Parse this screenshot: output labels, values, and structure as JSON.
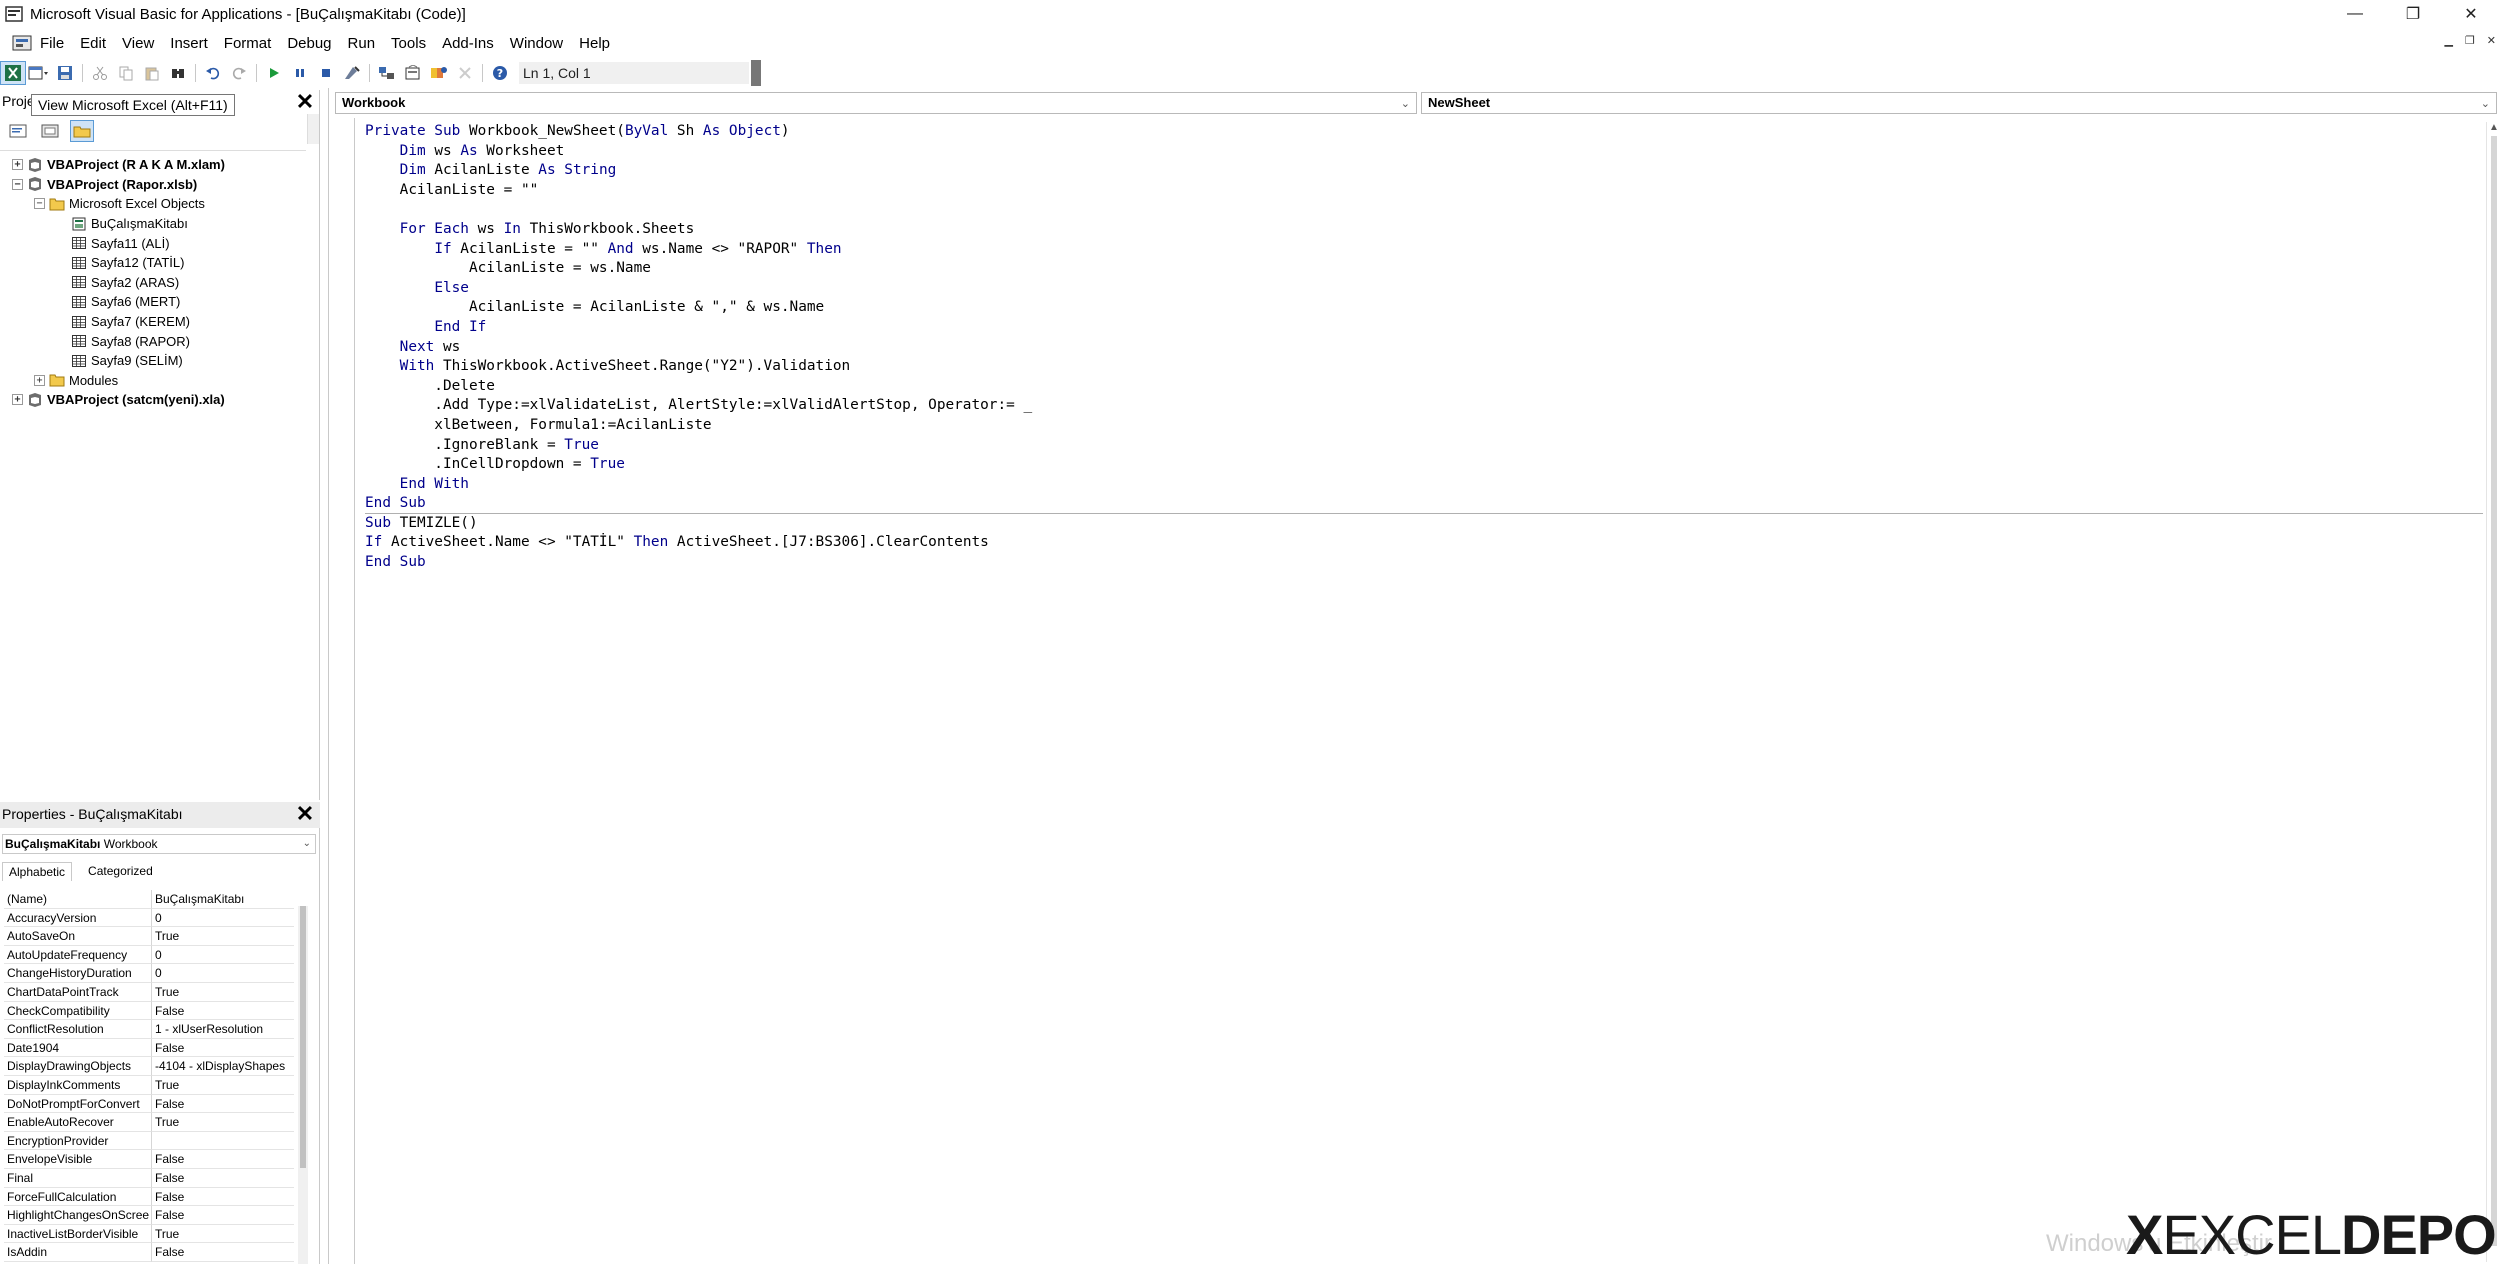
{
  "window": {
    "title": "Microsoft Visual Basic for Applications - [BuÇalışmaKitabı (Code)]",
    "minimize_glyph": "—",
    "restore_glyph": "❐",
    "close_glyph": "✕"
  },
  "menu": {
    "items": [
      "File",
      "Edit",
      "View",
      "Insert",
      "Format",
      "Debug",
      "Run",
      "Tools",
      "Add-Ins",
      "Window",
      "Help"
    ],
    "mdi_buttons": [
      "▁",
      "❐",
      "✕"
    ]
  },
  "toolbar": {
    "cursor_position": "Ln 1, Col 1",
    "tooltip": "View Microsoft Excel (Alt+F11)",
    "icons": [
      "excel-view-icon",
      "insert-userform-icon",
      "save-icon",
      "cut-icon",
      "copy-icon",
      "paste-icon",
      "find-icon",
      "undo-icon",
      "redo-icon",
      "run-icon",
      "break-icon",
      "reset-icon",
      "design-mode-icon",
      "project-explorer-icon",
      "properties-window-icon",
      "object-browser-icon",
      "toolbox-icon",
      "help-icon"
    ]
  },
  "project_pane": {
    "title": "Proje",
    "close_label": "✕",
    "tree": [
      {
        "label": "VBAProject (R A K A M.xlam)",
        "level": 0,
        "expander": "+",
        "bold": true,
        "icon": "vbaproject-icon"
      },
      {
        "label": "VBAProject (Rapor.xlsb)",
        "level": 0,
        "expander": "−",
        "bold": true,
        "icon": "vbaproject-icon"
      },
      {
        "label": "Microsoft Excel Objects",
        "level": 1,
        "expander": "−",
        "bold": false,
        "icon": "folder-icon"
      },
      {
        "label": "BuÇalışmaKitabı",
        "level": 2,
        "expander": "",
        "bold": false,
        "icon": "workbook-icon"
      },
      {
        "label": "Sayfa11 (ALİ)",
        "level": 2,
        "expander": "",
        "bold": false,
        "icon": "worksheet-icon"
      },
      {
        "label": "Sayfa12 (TATİL)",
        "level": 2,
        "expander": "",
        "bold": false,
        "icon": "worksheet-icon"
      },
      {
        "label": "Sayfa2 (ARAS)",
        "level": 2,
        "expander": "",
        "bold": false,
        "icon": "worksheet-icon"
      },
      {
        "label": "Sayfa6 (MERT)",
        "level": 2,
        "expander": "",
        "bold": false,
        "icon": "worksheet-icon"
      },
      {
        "label": "Sayfa7 (KEREM)",
        "level": 2,
        "expander": "",
        "bold": false,
        "icon": "worksheet-icon"
      },
      {
        "label": "Sayfa8 (RAPOR)",
        "level": 2,
        "expander": "",
        "bold": false,
        "icon": "worksheet-icon"
      },
      {
        "label": "Sayfa9 (SELİM)",
        "level": 2,
        "expander": "",
        "bold": false,
        "icon": "worksheet-icon"
      },
      {
        "label": "Modules",
        "level": 1,
        "expander": "+",
        "bold": false,
        "icon": "folder-icon"
      },
      {
        "label": "VBAProject (satcm(yeni).xla)",
        "level": 0,
        "expander": "+",
        "bold": true,
        "icon": "vbaproject-icon"
      }
    ]
  },
  "properties_pane": {
    "title": "Properties - BuÇalışmaKitabı",
    "close_label": "✕",
    "object_name": "BuÇalışmaKitabı",
    "object_type": "Workbook",
    "tabs": [
      "Alphabetic",
      "Categorized"
    ],
    "rows": [
      {
        "name": "(Name)",
        "value": "BuÇalışmaKitabı"
      },
      {
        "name": "AccuracyVersion",
        "value": "0"
      },
      {
        "name": "AutoSaveOn",
        "value": "True"
      },
      {
        "name": "AutoUpdateFrequency",
        "value": "0"
      },
      {
        "name": "ChangeHistoryDuration",
        "value": "0"
      },
      {
        "name": "ChartDataPointTrack",
        "value": "True"
      },
      {
        "name": "CheckCompatibility",
        "value": "False"
      },
      {
        "name": "ConflictResolution",
        "value": "1 - xlUserResolution"
      },
      {
        "name": "Date1904",
        "value": "False"
      },
      {
        "name": "DisplayDrawingObjects",
        "value": "-4104 - xlDisplayShapes"
      },
      {
        "name": "DisplayInkComments",
        "value": "True"
      },
      {
        "name": "DoNotPromptForConvert",
        "value": "False"
      },
      {
        "name": "EnableAutoRecover",
        "value": "True"
      },
      {
        "name": "EncryptionProvider",
        "value": ""
      },
      {
        "name": "EnvelopeVisible",
        "value": "False"
      },
      {
        "name": "Final",
        "value": "False"
      },
      {
        "name": "ForceFullCalculation",
        "value": "False"
      },
      {
        "name": "HighlightChangesOnScree",
        "value": "False"
      },
      {
        "name": "InactiveListBorderVisible",
        "value": "True"
      },
      {
        "name": "IsAddin",
        "value": "False"
      }
    ]
  },
  "code_window": {
    "object_combo": "Workbook",
    "procedure_combo": "NewSheet",
    "lines": [
      [
        {
          "t": "Private Sub",
          "k": true
        },
        {
          "t": " Workbook_NewSheet("
        },
        {
          "t": "ByVal",
          "k": true
        },
        {
          "t": " Sh "
        },
        {
          "t": "As Object",
          "k": true
        },
        {
          "t": ")"
        }
      ],
      [
        {
          "t": "    "
        },
        {
          "t": "Dim",
          "k": true
        },
        {
          "t": " ws "
        },
        {
          "t": "As",
          "k": true
        },
        {
          "t": " Worksheet"
        }
      ],
      [
        {
          "t": "    "
        },
        {
          "t": "Dim",
          "k": true
        },
        {
          "t": " AcilanListe "
        },
        {
          "t": "As String",
          "k": true
        }
      ],
      [
        {
          "t": "    AcilanListe = \"\""
        }
      ],
      [
        {
          "t": ""
        }
      ],
      [
        {
          "t": "    "
        },
        {
          "t": "For Each",
          "k": true
        },
        {
          "t": " ws "
        },
        {
          "t": "In",
          "k": true
        },
        {
          "t": " ThisWorkbook.Sheets"
        }
      ],
      [
        {
          "t": "        "
        },
        {
          "t": "If",
          "k": true
        },
        {
          "t": " AcilanListe = \"\" "
        },
        {
          "t": "And",
          "k": true
        },
        {
          "t": " ws.Name <> \"RAPOR\" "
        },
        {
          "t": "Then",
          "k": true
        }
      ],
      [
        {
          "t": "            AcilanListe = ws.Name"
        }
      ],
      [
        {
          "t": "        "
        },
        {
          "t": "Else",
          "k": true
        }
      ],
      [
        {
          "t": "            AcilanListe = AcilanListe & \",\" & ws.Name"
        }
      ],
      [
        {
          "t": "        "
        },
        {
          "t": "End If",
          "k": true
        }
      ],
      [
        {
          "t": "    "
        },
        {
          "t": "Next",
          "k": true
        },
        {
          "t": " ws"
        }
      ],
      [
        {
          "t": "    "
        },
        {
          "t": "With",
          "k": true
        },
        {
          "t": " ThisWorkbook.ActiveSheet.Range(\"Y2\").Validation"
        }
      ],
      [
        {
          "t": "        .Delete"
        }
      ],
      [
        {
          "t": "        .Add Type:=xlValidateList, AlertStyle:=xlValidAlertStop, Operator:= _"
        }
      ],
      [
        {
          "t": "        xlBetween, Formula1:=AcilanListe"
        }
      ],
      [
        {
          "t": "        .IgnoreBlank = "
        },
        {
          "t": "True",
          "k": true
        }
      ],
      [
        {
          "t": "        .InCellDropdown = "
        },
        {
          "t": "True",
          "k": true
        }
      ],
      [
        {
          "t": "    "
        },
        {
          "t": "End With",
          "k": true
        }
      ],
      [
        {
          "t": "End Sub",
          "k": true
        }
      ],
      [
        {
          "t": "Sub",
          "k": true
        },
        {
          "t": " TEMIZLE()"
        }
      ],
      [
        {
          "t": "If",
          "k": true
        },
        {
          "t": " ActiveSheet.Name <> \"TATİL\" "
        },
        {
          "t": "Then",
          "k": true
        },
        {
          "t": " ActiveSheet.[J7:BS306].ClearContents"
        }
      ],
      [
        {
          "t": "End Sub",
          "k": true
        }
      ]
    ]
  },
  "watermark": {
    "windows_text": "Windows'u Etkinleştir",
    "logo_x": "X",
    "logo_excel": "EXCEL",
    "logo_depo": "DEPO"
  },
  "colors": {
    "keyword": "#00008b",
    "selection": "#cfe3f6",
    "selection_border": "#5b9bd5"
  }
}
